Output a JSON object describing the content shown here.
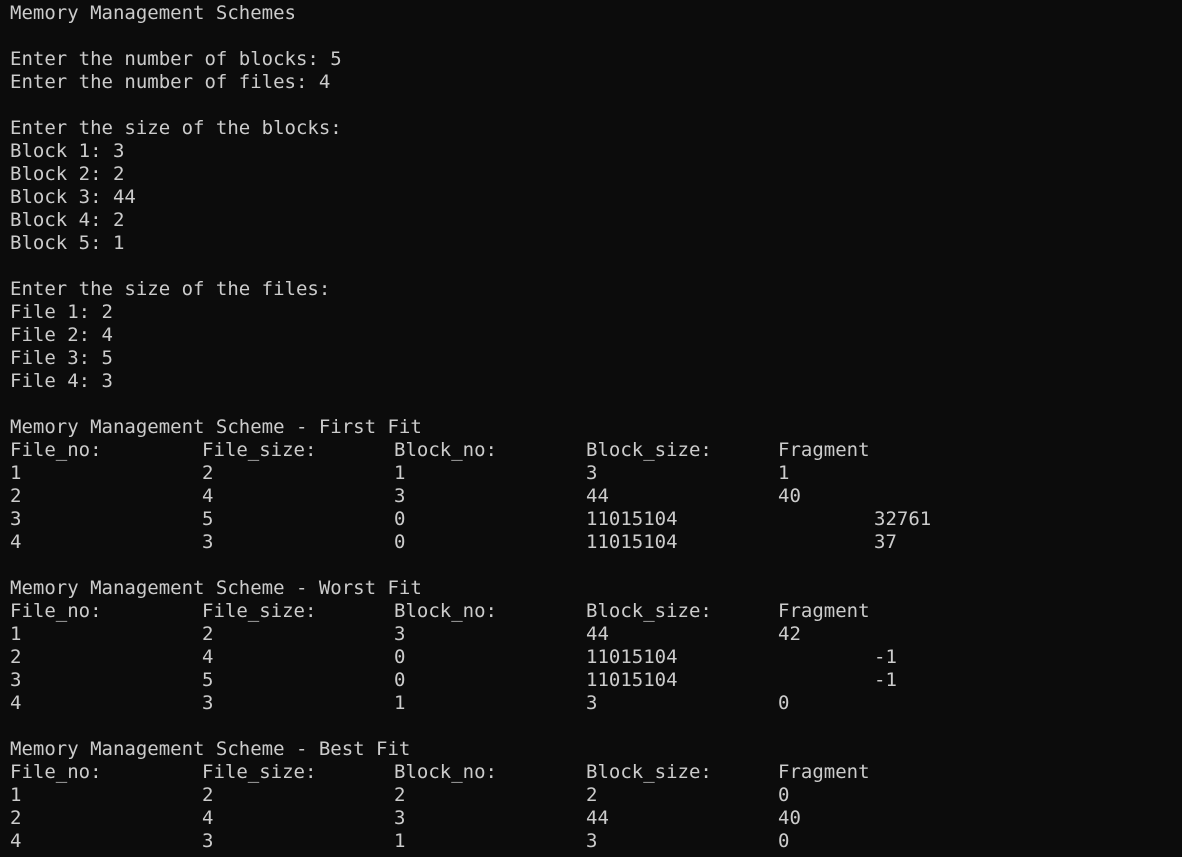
{
  "header": "Memory Management Schemes",
  "inputs": {
    "blocks_prompt": "Enter the number of blocks: 5",
    "files_prompt": "Enter the number of files: 4",
    "block_sizes_prompt": "Enter the size of the blocks:",
    "blocks": [
      "Block 1: 3",
      "Block 2: 2",
      "Block 3: 44",
      "Block 4: 2",
      "Block 5: 1"
    ],
    "file_sizes_prompt": "Enter the size of the files:",
    "files": [
      "File 1: 2",
      "File 2: 4",
      "File 3: 5",
      "File 4: 3"
    ]
  },
  "columns": [
    "File_no:",
    "File_size:",
    "Block_no:",
    "Block_size:",
    "Fragment"
  ],
  "schemes": [
    {
      "title": "Memory Management Scheme - First Fit",
      "rows": [
        [
          "1",
          "2",
          "1",
          "3",
          "1"
        ],
        [
          "2",
          "4",
          "3",
          "44",
          "40"
        ],
        [
          "3",
          "5",
          "0",
          "11015104",
          "32761"
        ],
        [
          "4",
          "3",
          "0",
          "11015104",
          "37"
        ]
      ]
    },
    {
      "title": "Memory Management Scheme - Worst Fit",
      "rows": [
        [
          "1",
          "2",
          "3",
          "44",
          "42"
        ],
        [
          "2",
          "4",
          "0",
          "11015104",
          "-1"
        ],
        [
          "3",
          "5",
          "0",
          "11015104",
          "-1"
        ],
        [
          "4",
          "3",
          "1",
          "3",
          "0"
        ]
      ]
    },
    {
      "title": "Memory Management Scheme - Best Fit",
      "rows": [
        [
          "1",
          "2",
          "2",
          "2",
          "0"
        ],
        [
          "2",
          "4",
          "3",
          "44",
          "40"
        ],
        [
          "4",
          "3",
          "1",
          "3",
          "0"
        ]
      ]
    }
  ]
}
